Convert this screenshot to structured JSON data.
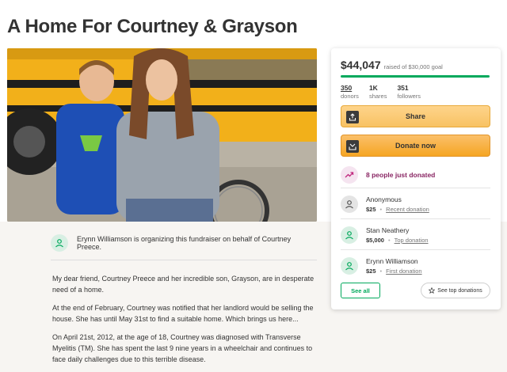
{
  "page": {
    "title": "A Home For Courtney & Grayson"
  },
  "organizer": {
    "text": "Erynn Williamson is organizing this fundraiser on behalf of Courtney Preece."
  },
  "story": {
    "paragraphs": [
      "My dear friend, Courtney Preece and her incredible son, Grayson, are in desperate need of a home.",
      "At the end of February, Courtney was notified that her landlord would be selling the house. She has until May 31st to find a suitable home. Which brings us here...",
      "On April 21st, 2012, at the age of 18, Courtney was diagnosed with Transverse Myelitis (TM).  She has spent the last 9 nine years in a wheelchair and continues to face daily challenges due to this terrible disease."
    ]
  },
  "panel": {
    "amount": "$44,047",
    "goal_text": "raised of $30,000 goal",
    "progress_fraction": 1.0,
    "stats": [
      {
        "value": "350",
        "label": "donors"
      },
      {
        "value": "1K",
        "label": "shares"
      },
      {
        "value": "351",
        "label": "followers"
      }
    ],
    "share_label": "Share",
    "donate_label": "Donate now",
    "recent_text": "8 people just donated",
    "donations": [
      {
        "name": "Anonymous",
        "amount": "$25",
        "tag": "Recent donation"
      },
      {
        "name": "Stan Neathery",
        "amount": "$5,000",
        "tag": "Top donation"
      },
      {
        "name": "Erynn Williamson",
        "amount": "$25",
        "tag": "First donation"
      }
    ],
    "see_all_label": "See all",
    "see_top_label": "See top donations"
  },
  "colors": {
    "brand_green": "#02a95c",
    "button_orange": "#f8c263",
    "recent_purple": "#892563"
  },
  "icons": {
    "share": "share-upload-icon",
    "donate": "donate-box-icon",
    "recent": "trending-up-icon",
    "donor_anonymous": "user-icon",
    "donor": "user-icon",
    "see_top": "star-icon"
  }
}
